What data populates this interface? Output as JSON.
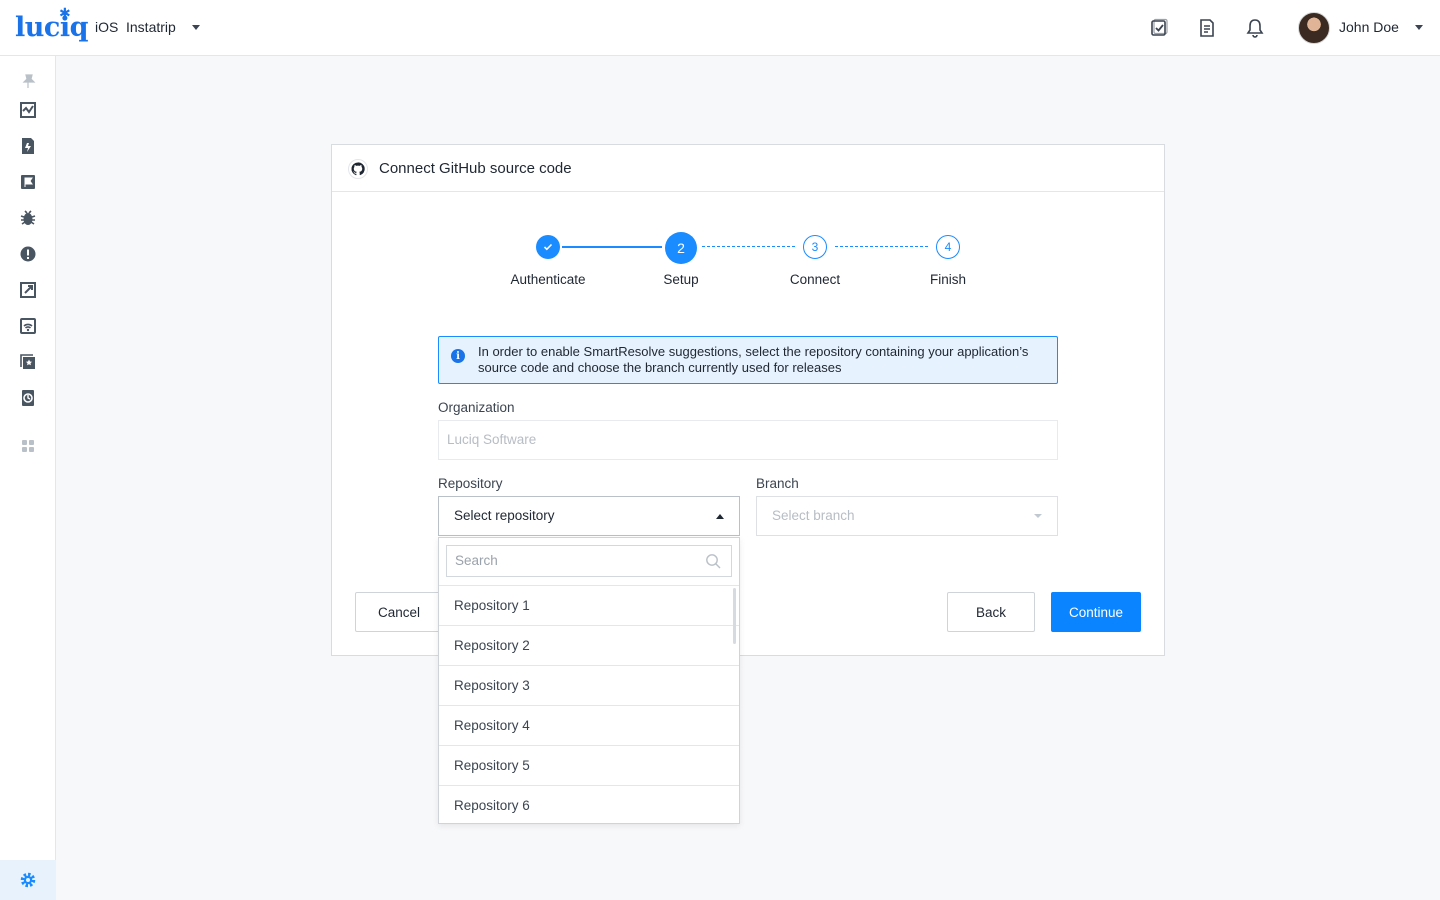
{
  "app": {
    "logo": "luciq",
    "platform": "iOS",
    "name": "Instatrip"
  },
  "user": {
    "name": "John Doe"
  },
  "topbar_icons": [
    "checklist-icon",
    "document-icon",
    "bell-icon"
  ],
  "sidebar_icons": [
    "pin-icon",
    "dashboard-icon",
    "crash-report-icon",
    "feedback-icon",
    "bug-icon",
    "alert-icon",
    "rocket-icon",
    "network-icon",
    "reviews-icon",
    "sessions-icon",
    "apps-grid-icon",
    "gear-icon"
  ],
  "card": {
    "title": "Connect GitHub source code"
  },
  "stepper": {
    "steps": [
      {
        "number": "1",
        "label": "Authenticate",
        "state": "done"
      },
      {
        "number": "2",
        "label": "Setup",
        "state": "active"
      },
      {
        "number": "3",
        "label": "Connect",
        "state": "todo"
      },
      {
        "number": "4",
        "label": "Finish",
        "state": "todo"
      }
    ]
  },
  "info": {
    "text": "In order to enable SmartResolve suggestions, select the repository containing your application’s source code and choose the branch currently used for releases"
  },
  "form": {
    "organization_label": "Organization",
    "organization_value": "Luciq Software",
    "repository_label": "Repository",
    "repository_value": "Select repository",
    "branch_label": "Branch",
    "branch_placeholder": "Select branch"
  },
  "dropdown": {
    "search_placeholder": "Search",
    "items": [
      "Repository 1",
      "Repository 2",
      "Repository 3",
      "Repository 4",
      "Repository 5",
      "Repository 6"
    ]
  },
  "buttons": {
    "cancel": "Cancel",
    "back": "Back",
    "continue": "Continue"
  },
  "colors": {
    "accent": "#0a84ff",
    "info_bg": "#e6f2fd"
  }
}
